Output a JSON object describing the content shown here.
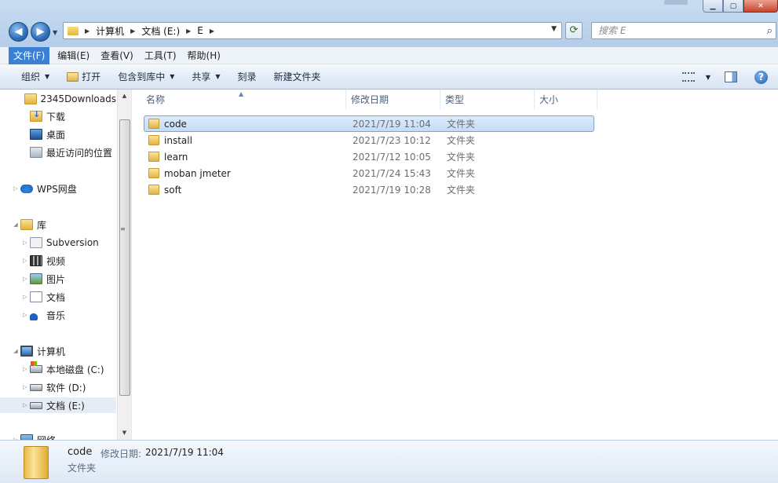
{
  "address": {
    "crumbs": [
      "计算机",
      "文档 (E:)",
      "E"
    ]
  },
  "search": {
    "placeholder": "搜索 E"
  },
  "menu": [
    "文件(F)",
    "编辑(E)",
    "查看(V)",
    "工具(T)",
    "帮助(H)"
  ],
  "commands": {
    "organize": "组织",
    "open": "打开",
    "include": "包含到库中",
    "share": "共享",
    "burn": "刻录",
    "new_folder": "新建文件夹"
  },
  "nav": {
    "items": [
      {
        "label": "2345Downloads",
        "icon": "folder-icon"
      },
      {
        "label": "下载",
        "icon": "download-folder-icon"
      },
      {
        "label": "桌面",
        "icon": "desktop-icon"
      },
      {
        "label": "最近访问的位置",
        "icon": "recent-places-icon"
      },
      {
        "label": "WPS网盘",
        "icon": "cloud-icon"
      },
      {
        "label": "库",
        "icon": "library-icon"
      },
      {
        "label": "Subversion",
        "icon": "subversion-icon"
      },
      {
        "label": "视频",
        "icon": "video-icon"
      },
      {
        "label": "图片",
        "icon": "pictures-icon"
      },
      {
        "label": "文档",
        "icon": "documents-icon"
      },
      {
        "label": "音乐",
        "icon": "music-icon"
      },
      {
        "label": "计算机",
        "icon": "computer-icon"
      },
      {
        "label": "本地磁盘 (C:)",
        "icon": "drive-c-icon"
      },
      {
        "label": "软件 (D:)",
        "icon": "drive-icon"
      },
      {
        "label": "文档 (E:)",
        "icon": "drive-icon"
      },
      {
        "label": "网络",
        "icon": "network-icon"
      }
    ]
  },
  "columns": {
    "name": "名称",
    "date": "修改日期",
    "type": "类型",
    "size": "大小"
  },
  "files": [
    {
      "name": "code",
      "date": "2021/7/19 11:04",
      "type": "文件夹"
    },
    {
      "name": "install",
      "date": "2021/7/23 10:12",
      "type": "文件夹"
    },
    {
      "name": "learn",
      "date": "2021/7/12 10:05",
      "type": "文件夹"
    },
    {
      "name": "moban jmeter",
      "date": "2021/7/24 15:43",
      "type": "文件夹"
    },
    {
      "name": "soft",
      "date": "2021/7/19 10:28",
      "type": "文件夹"
    }
  ],
  "details": {
    "name": "code",
    "date_label": "修改日期:",
    "date": "2021/7/19 11:04",
    "type": "文件夹"
  }
}
